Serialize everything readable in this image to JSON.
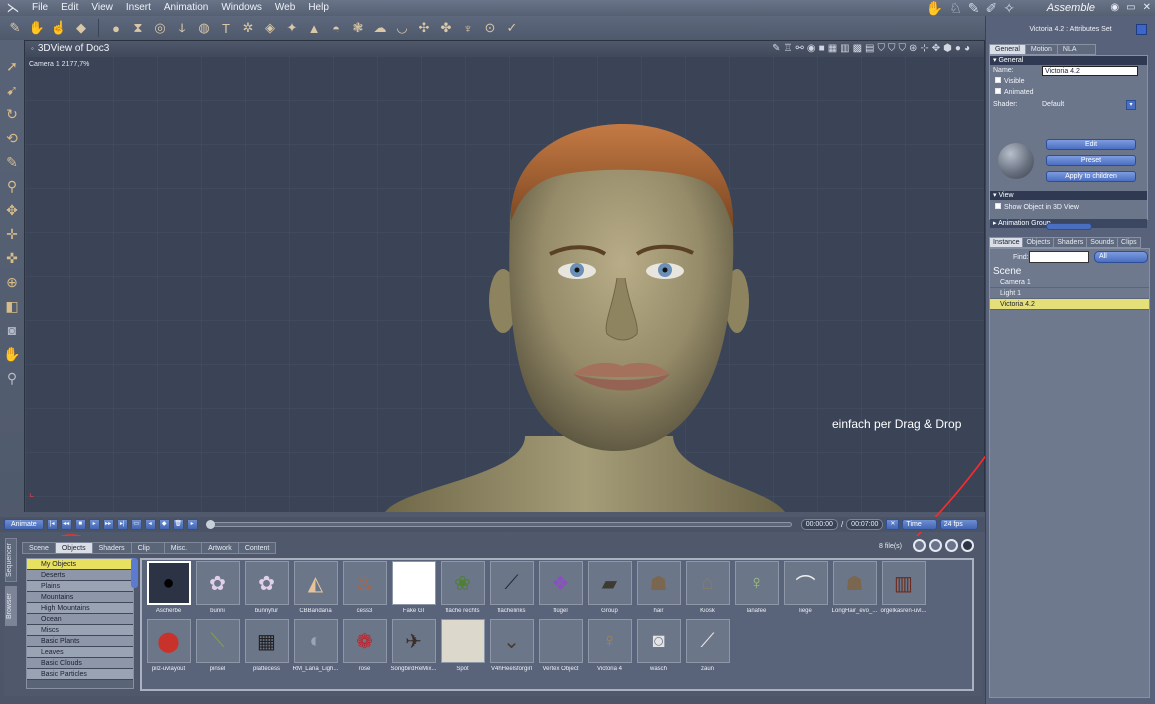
{
  "menubar": {
    "items": [
      "File",
      "Edit",
      "View",
      "Insert",
      "Animation",
      "Windows",
      "Web",
      "Help"
    ],
    "room_title": "Assemble"
  },
  "viewport": {
    "title": "3DView of Doc3",
    "camera_label": "Camera 1 2177,7%",
    "annotation": "einfach per Drag & Drop"
  },
  "timeline": {
    "animate_label": "Animate",
    "current_time": "00:00:00",
    "separator": "/",
    "total_time": "00:07:00",
    "time_mode": "Time",
    "fps": "24 fps"
  },
  "browser": {
    "side_tabs": [
      "Sequencer",
      "Browser"
    ],
    "tabs": [
      "Scene",
      "Objects",
      "Shaders",
      "Clip",
      "Misc.",
      "Artwork",
      "Content"
    ],
    "active_tab": "Objects",
    "file_count": "8 file(s)",
    "categories": [
      "My Objects",
      "Deserts",
      "Plains",
      "Mountains",
      "High Mountains",
      "Ocean",
      "Miscs",
      "Basic Plants",
      "Leaves",
      "Basic Clouds",
      "Basic Particles"
    ],
    "selected_category": "My Objects",
    "assets": [
      {
        "name": "Ascherbe",
        "icon": "black-disc"
      },
      {
        "name": "bunni",
        "icon": "figure"
      },
      {
        "name": "bunnyfur",
        "icon": "figure"
      },
      {
        "name": "CBBandana",
        "icon": "primitives"
      },
      {
        "name": "cess3",
        "icon": "bottle"
      },
      {
        "name": "Fake GI",
        "icon": "white-square"
      },
      {
        "name": "fläche rechts",
        "icon": "plant-patch"
      },
      {
        "name": "flächelinks",
        "icon": "stick"
      },
      {
        "name": "flügel",
        "icon": "crystal"
      },
      {
        "name": "Group",
        "icon": "box"
      },
      {
        "name": "hair",
        "icon": "hair"
      },
      {
        "name": "Kiosk",
        "icon": "building"
      },
      {
        "name": "lanafee",
        "icon": "fairy"
      },
      {
        "name": "liege",
        "icon": "lounger"
      },
      {
        "name": "LongHair_evo_...",
        "icon": "hair"
      },
      {
        "name": "orgelkasren-uvl...",
        "icon": "cabinet"
      },
      {
        "name": "pilz-uvlayout",
        "icon": "mushroom"
      },
      {
        "name": "pinsel",
        "icon": "brush"
      },
      {
        "name": "plattecess",
        "icon": "checker"
      },
      {
        "name": "RM_Lana_Ligh...",
        "icon": "light"
      },
      {
        "name": "rose",
        "icon": "rose"
      },
      {
        "name": "SongbirdReMix...",
        "icon": "bird"
      },
      {
        "name": "Spot",
        "icon": "spot"
      },
      {
        "name": "V4hHeelsforgirl",
        "icon": "heels"
      },
      {
        "name": "Vertex Object",
        "icon": "empty"
      },
      {
        "name": "Victoria 4",
        "icon": "figure-standing"
      },
      {
        "name": "wasch",
        "icon": "washer"
      },
      {
        "name": "zaun",
        "icon": "fence"
      }
    ]
  },
  "attributes": {
    "title": "Victoria 4.2 : Attributes Set",
    "tabs": [
      "General",
      "Motion",
      "NLA"
    ],
    "active_tab": "General",
    "general_header": "General",
    "name_label": "Name:",
    "name_value": "Victoria 4.2",
    "visible_label": "Visible",
    "animated_label": "Animated",
    "shader_label": "Shader:",
    "shader_value": "Default",
    "edit_label": "Edit",
    "preset_label": "Preset",
    "apply_label": "Apply to children",
    "view_header": "View",
    "show_object_label": "Show Object in 3D View",
    "animation_group": "Animation Group"
  },
  "instances": {
    "tabs": [
      "Instance",
      "Objects",
      "Shaders",
      "Sounds",
      "Clips"
    ],
    "active_tab": "Instance",
    "find_label": "Find:",
    "find_value": "",
    "filter_value": "All",
    "scene_header": "Scene",
    "items": [
      "Camera 1",
      "Light 1",
      "Victoria 4.2"
    ],
    "selected_item": "Victoria 4.2"
  },
  "colors": {
    "selection": "#e5df7a",
    "accent_blue": "#4b6fc0",
    "annotation_red": "#ff2a2a"
  }
}
